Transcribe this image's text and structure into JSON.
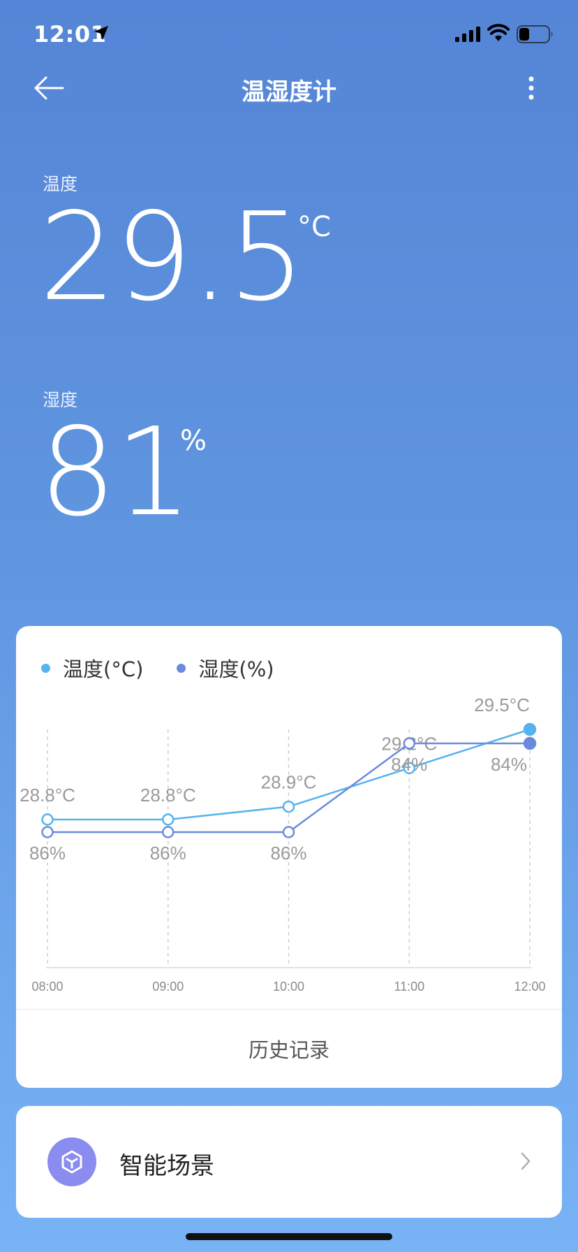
{
  "status_bar": {
    "time": "12:01",
    "battery_level": 0.35
  },
  "nav": {
    "title": "温湿度计",
    "back_icon": "arrow-left-icon",
    "menu_icon": "more-vertical-icon"
  },
  "temperature": {
    "label": "温度",
    "value": "29.5",
    "unit": "°C"
  },
  "humidity": {
    "label": "湿度",
    "value": "81",
    "unit": "%"
  },
  "colors": {
    "temperature_series": "#55b3ee",
    "humidity_series": "#6a8bdc",
    "background_top": "#5585d6",
    "background_bottom": "#78b3f6"
  },
  "chart_data": {
    "type": "line",
    "x": [
      "08:00",
      "09:00",
      "10:00",
      "11:00",
      "12:00"
    ],
    "series": [
      {
        "name": "温度(°C)",
        "values": [
          28.8,
          28.8,
          28.9,
          29.2,
          29.5
        ],
        "labels": [
          "28.8°C",
          "28.8°C",
          "28.9°C",
          "29.2°C",
          "29.5°C"
        ],
        "color": "#55b3ee"
      },
      {
        "name": "湿度(%)",
        "values": [
          86,
          86,
          86,
          84,
          84
        ],
        "labels": [
          "86%",
          "86%",
          "86%",
          "84%",
          "84%"
        ],
        "color": "#6a8bdc"
      }
    ],
    "grid": "vertical dashed",
    "legend": "top-left"
  },
  "chart_card": {
    "history_label": "历史记录"
  },
  "scene_card": {
    "label": "智能场景",
    "icon": "cube-icon",
    "chevron_icon": "chevron-right-icon"
  }
}
